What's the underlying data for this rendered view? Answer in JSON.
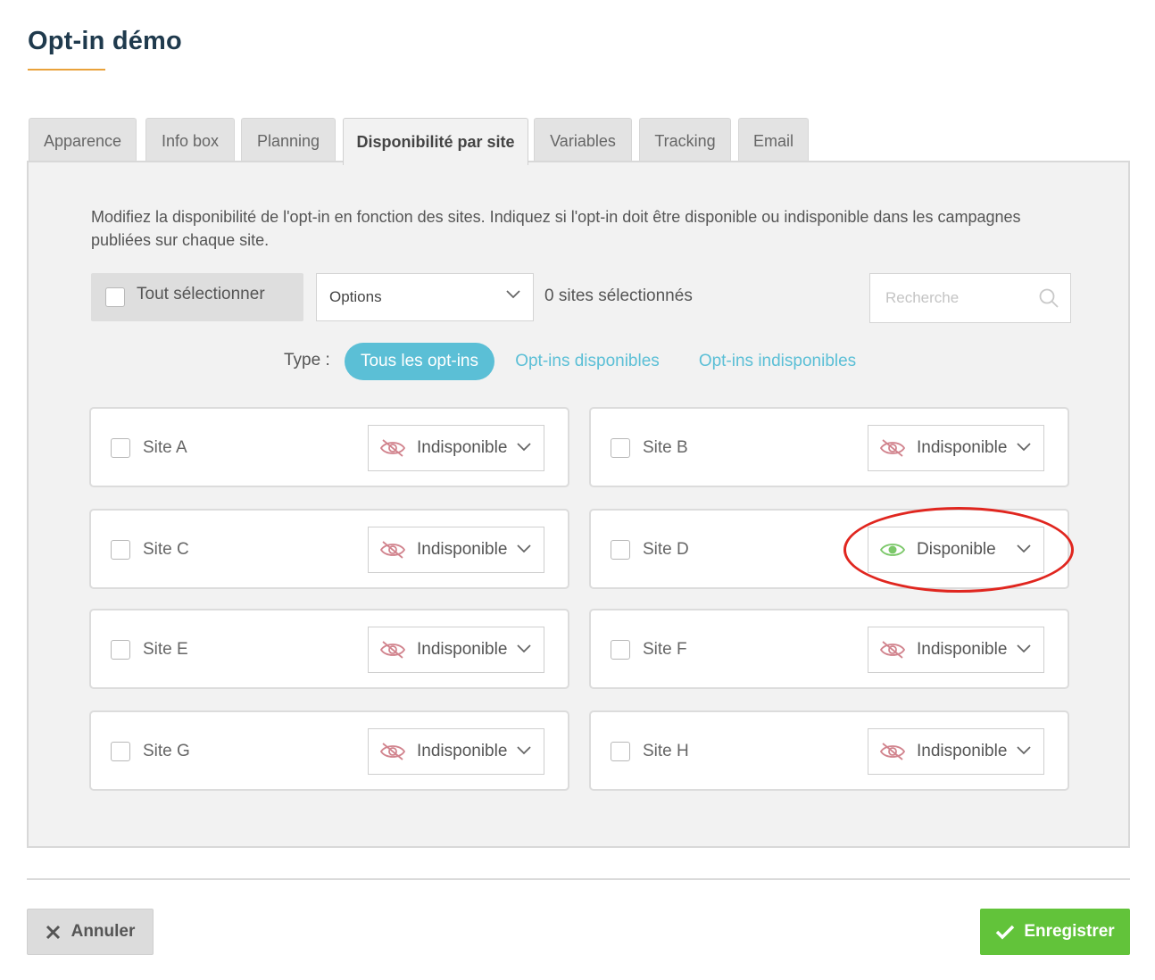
{
  "page": {
    "title": "Opt-in démo"
  },
  "tabs": [
    {
      "label": "Apparence",
      "active": false
    },
    {
      "label": "Info box",
      "active": false
    },
    {
      "label": "Planning",
      "active": false
    },
    {
      "label": "Disponibilité par site",
      "active": true
    },
    {
      "label": "Variables",
      "active": false
    },
    {
      "label": "Tracking",
      "active": false
    },
    {
      "label": "Email",
      "active": false
    }
  ],
  "panel": {
    "intro": "Modifiez la disponibilité de l'opt-in en fonction des sites. Indiquez si l'opt-in doit être disponible ou indisponible dans les campagnes publiées sur chaque site.",
    "select_all_label": "Tout sélectionner",
    "options_select": "Options",
    "selected_count": "0 sites sélectionnés",
    "search_placeholder": "Recherche",
    "type_label": "Type :",
    "type_filters": [
      {
        "label": "Tous les opt-ins",
        "active": true
      },
      {
        "label": "Opt-ins disponibles",
        "active": false
      },
      {
        "label": "Opt-ins indisponibles",
        "active": false
      }
    ]
  },
  "sites": [
    {
      "name": "Site A",
      "status": "Indisponible",
      "status_icon": "eye-slash-icon"
    },
    {
      "name": "Site B",
      "status": "Indisponible",
      "status_icon": "eye-slash-icon"
    },
    {
      "name": "Site C",
      "status": "Indisponible",
      "status_icon": "eye-slash-icon"
    },
    {
      "name": "Site D",
      "status": "Disponible",
      "status_icon": "eye-icon",
      "highlighted": true
    },
    {
      "name": "Site E",
      "status": "Indisponible",
      "status_icon": "eye-slash-icon"
    },
    {
      "name": "Site F",
      "status": "Indisponible",
      "status_icon": "eye-slash-icon"
    },
    {
      "name": "Site G",
      "status": "Indisponible",
      "status_icon": "eye-slash-icon"
    },
    {
      "name": "Site H",
      "status": "Indisponible",
      "status_icon": "eye-slash-icon"
    }
  ],
  "footer": {
    "cancel_label": "Annuler",
    "save_label": "Enregistrer"
  },
  "colors": {
    "accent": "#5bbfd6",
    "title_underline": "#e9a23b",
    "unavailable": "#d1838d",
    "available": "#7cc86a",
    "save_button": "#62c33a",
    "highlight_circle": "#e0261f"
  }
}
